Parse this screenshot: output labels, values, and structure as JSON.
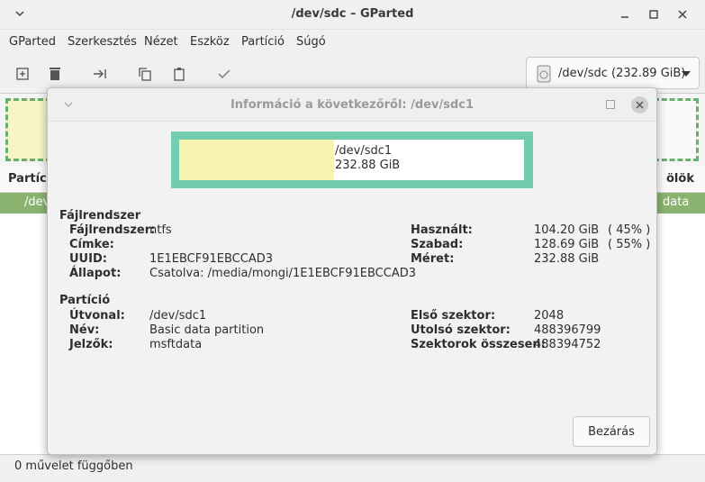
{
  "window": {
    "title": "/dev/sdc – GParted"
  },
  "menu": [
    "GParted",
    "Szerkesztés",
    "Nézet",
    "Eszköz",
    "Partíció",
    "Súgó"
  ],
  "toolbar": {
    "device": "/dev/sdc  (232.89 GiB)"
  },
  "list": {
    "header_first": "Partíció",
    "header_last": "ölök",
    "row_first": "/dev",
    "row_last": "data"
  },
  "status": "0 művelet függőben",
  "dialog": {
    "title": "Információ a következőről: /dev/sdc1",
    "bar": {
      "path": "/dev/sdc1",
      "size": "232.88 GiB",
      "used_fraction": 0.45
    },
    "filesystem_section": {
      "title": "Fájlrendszer",
      "fields": [
        {
          "label": "Fájlrendszer:",
          "value": "ntfs"
        },
        {
          "label": "Címke:",
          "value": ""
        },
        {
          "label": "UUID:",
          "value": "1E1EBCF91EBCCAD3"
        },
        {
          "label": "Állapot:",
          "value": "Csatolva: /media/mongi/1E1EBCF91EBCCAD3"
        }
      ],
      "usage": [
        {
          "label": "Használt:",
          "value": "104.20 GiB",
          "pct": "( 45% )"
        },
        {
          "label": "Szabad:",
          "value": "128.69 GiB",
          "pct": "( 55% )"
        },
        {
          "label": "Méret:",
          "value": "232.88 GiB",
          "pct": ""
        }
      ]
    },
    "partition_section": {
      "title": "Partíció",
      "fields": [
        {
          "label": "Útvonal:",
          "value": "/dev/sdc1"
        },
        {
          "label": "Név:",
          "value": "Basic data partition"
        },
        {
          "label": "Jelzők:",
          "value": "msftdata"
        }
      ],
      "sectors": [
        {
          "label": "Első szektor:",
          "value": "2048"
        },
        {
          "label": "Utolsó szektor:",
          "value": "488396799"
        },
        {
          "label": "Szektorok összesen:",
          "value": "488394752"
        }
      ]
    },
    "close_label": "Bezárás"
  }
}
